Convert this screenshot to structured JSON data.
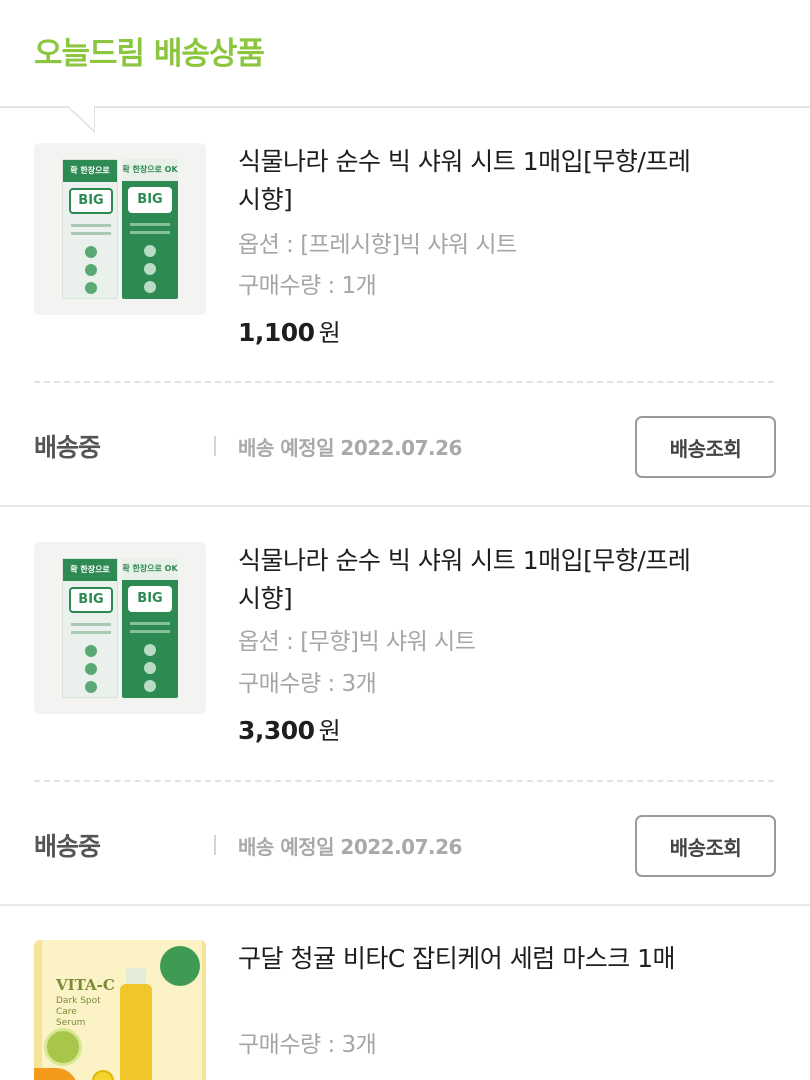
{
  "header": {
    "title": "오늘드림 배송상품"
  },
  "orders": [
    {
      "name": "식물나라 순수 빅 샤워 시트 1매입[무향/프레시향]",
      "option": "옵션 : [프레시향]빅 샤워 시트",
      "quantity": "구매수량 : 1개",
      "price": "1,100",
      "price_unit": "원",
      "status": "배송중",
      "eta": "배송 예정일 2022.07.26",
      "track_label": "배송조회",
      "thumb_text": {
        "top": "확 한장으로 OK",
        "badge": "BIG"
      }
    },
    {
      "name": "식물나라 순수 빅 샤워 시트 1매입[무향/프레시향]",
      "option": "옵션 : [무향]빅 샤워 시트",
      "quantity": "구매수량 : 3개",
      "price": "3,300",
      "price_unit": "원",
      "status": "배송중",
      "eta": "배송 예정일 2022.07.26",
      "track_label": "배송조회",
      "thumb_text": {
        "top": "확 한장으로 OK",
        "badge": "BIG"
      }
    },
    {
      "name": "구달 청귤 비타C 잡티케어 세럼 마스크 1매",
      "quantity": "구매수량 : 3개",
      "thumb_text": {
        "title": "VITA-C",
        "sub": "Dark Spot Care Serum"
      }
    }
  ],
  "colors": {
    "brand_green": "#8cc63f",
    "pack_green": "#2d8a52",
    "muted_text": "#a6a6a6"
  }
}
